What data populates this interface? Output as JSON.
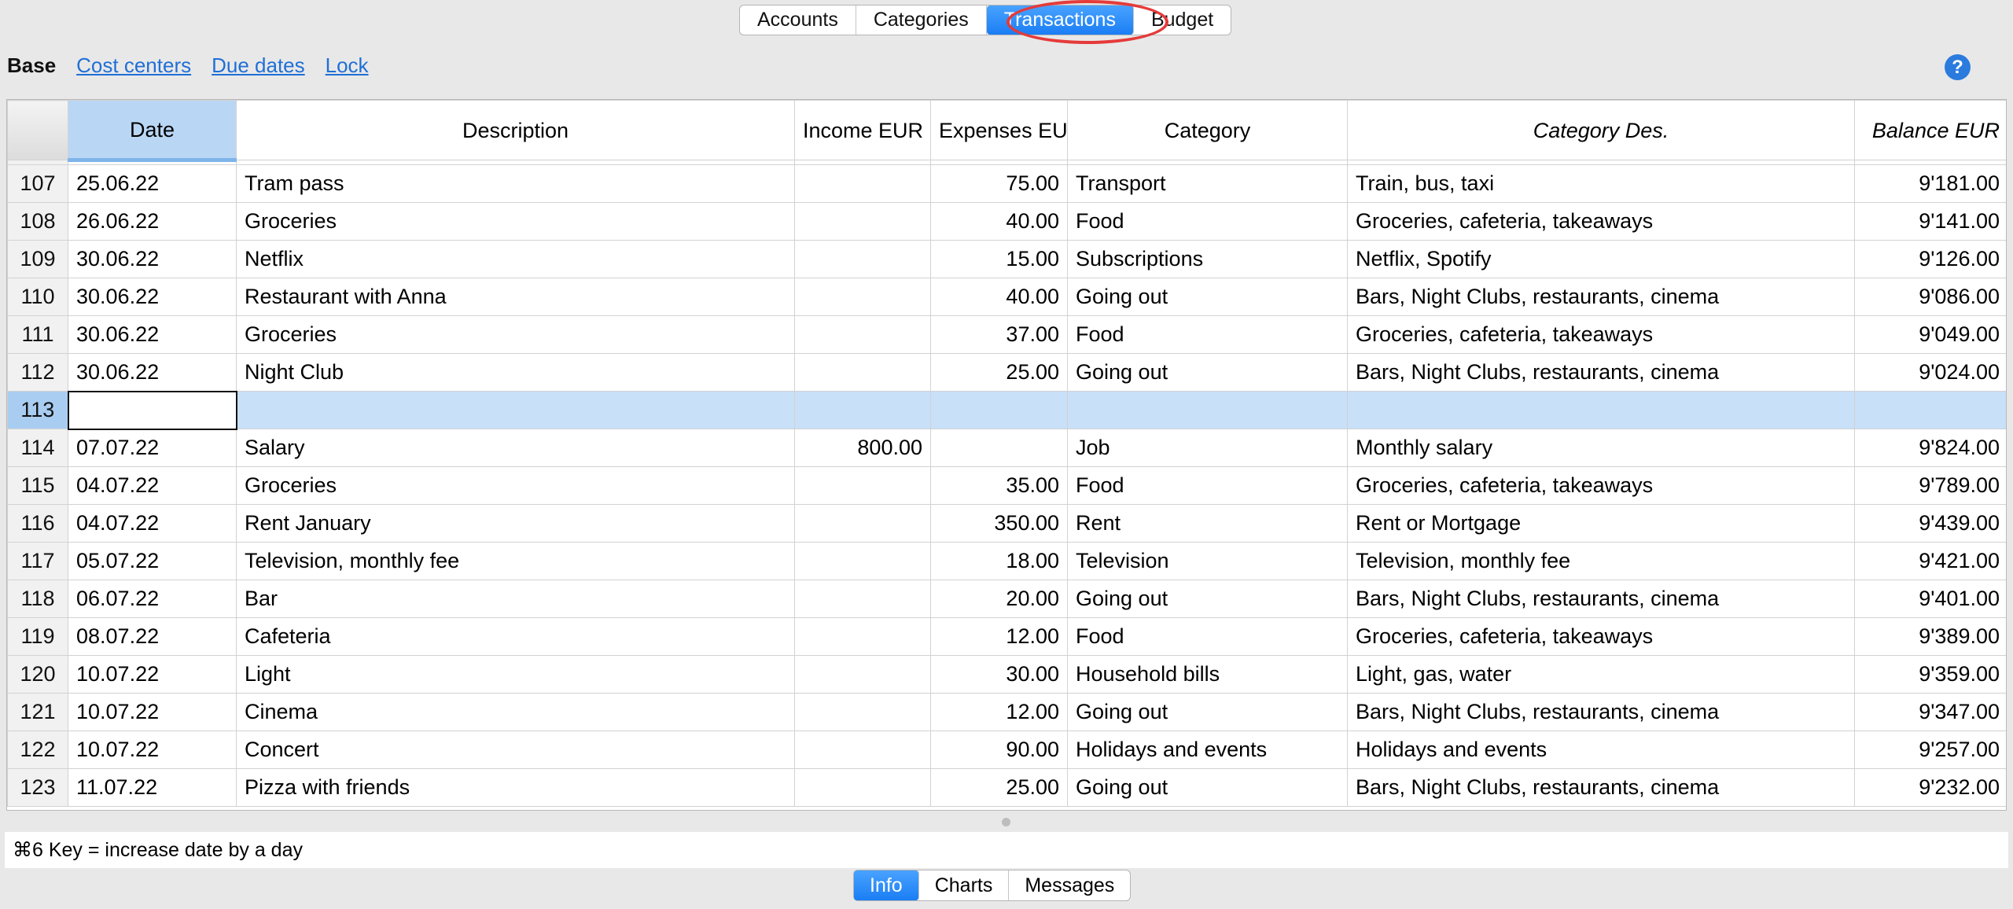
{
  "top_tabs": [
    "Accounts",
    "Categories",
    "Transactions",
    "Budget"
  ],
  "active_top_tab": "Transactions",
  "view_bar": {
    "base": "Base",
    "links": [
      "Cost centers",
      "Due dates",
      "Lock"
    ]
  },
  "help_label": "?",
  "table": {
    "columns": [
      "Date",
      "Description",
      "Income EUR",
      "Expenses EUR",
      "Category",
      "Category Des.",
      "Balance EUR"
    ],
    "rows": [
      {
        "n": "107",
        "date": "25.06.22",
        "desc": "Tram pass",
        "income": "",
        "expenses": "75.00",
        "category": "Transport",
        "catdes": "Train, bus, taxi",
        "balance": "9'181.00"
      },
      {
        "n": "108",
        "date": "26.06.22",
        "desc": "Groceries",
        "income": "",
        "expenses": "40.00",
        "category": "Food",
        "catdes": "Groceries, cafeteria, takeaways",
        "balance": "9'141.00"
      },
      {
        "n": "109",
        "date": "30.06.22",
        "desc": "Netflix",
        "income": "",
        "expenses": "15.00",
        "category": "Subscriptions",
        "catdes": "Netflix, Spotify",
        "balance": "9'126.00"
      },
      {
        "n": "110",
        "date": "30.06.22",
        "desc": "Restaurant with Anna",
        "income": "",
        "expenses": "40.00",
        "category": "Going out",
        "catdes": "Bars, Night Clubs, restaurants, cinema",
        "balance": "9'086.00"
      },
      {
        "n": "111",
        "date": "30.06.22",
        "desc": "Groceries",
        "income": "",
        "expenses": "37.00",
        "category": "Food",
        "catdes": "Groceries, cafeteria, takeaways",
        "balance": "9'049.00"
      },
      {
        "n": "112",
        "date": "30.06.22",
        "desc": "Night Club",
        "income": "",
        "expenses": "25.00",
        "category": "Going out",
        "catdes": "Bars, Night Clubs, restaurants, cinema",
        "balance": "9'024.00"
      },
      {
        "n": "113",
        "date": "",
        "desc": "",
        "income": "",
        "expenses": "",
        "category": "",
        "catdes": "",
        "balance": ""
      },
      {
        "n": "114",
        "date": "07.07.22",
        "desc": "Salary",
        "income": "800.00",
        "expenses": "",
        "category": "Job",
        "catdes": "Monthly salary",
        "balance": "9'824.00"
      },
      {
        "n": "115",
        "date": "04.07.22",
        "desc": "Groceries",
        "income": "",
        "expenses": "35.00",
        "category": "Food",
        "catdes": "Groceries, cafeteria, takeaways",
        "balance": "9'789.00"
      },
      {
        "n": "116",
        "date": "04.07.22",
        "desc": "Rent January",
        "income": "",
        "expenses": "350.00",
        "category": "Rent",
        "catdes": "Rent or Mortgage",
        "balance": "9'439.00"
      },
      {
        "n": "117",
        "date": "05.07.22",
        "desc": "Television, monthly fee",
        "income": "",
        "expenses": "18.00",
        "category": "Television",
        "catdes": "Television, monthly fee",
        "balance": "9'421.00"
      },
      {
        "n": "118",
        "date": "06.07.22",
        "desc": "Bar",
        "income": "",
        "expenses": "20.00",
        "category": "Going out",
        "catdes": "Bars, Night Clubs, restaurants, cinema",
        "balance": "9'401.00"
      },
      {
        "n": "119",
        "date": "08.07.22",
        "desc": "Cafeteria",
        "income": "",
        "expenses": "12.00",
        "category": "Food",
        "catdes": "Groceries, cafeteria, takeaways",
        "balance": "9'389.00"
      },
      {
        "n": "120",
        "date": "10.07.22",
        "desc": "Light",
        "income": "",
        "expenses": "30.00",
        "category": "Household bills",
        "catdes": "Light, gas, water",
        "balance": "9'359.00"
      },
      {
        "n": "121",
        "date": "10.07.22",
        "desc": "Cinema",
        "income": "",
        "expenses": "12.00",
        "category": "Going out",
        "catdes": "Bars, Night Clubs, restaurants, cinema",
        "balance": "9'347.00"
      },
      {
        "n": "122",
        "date": "10.07.22",
        "desc": "Concert",
        "income": "",
        "expenses": "90.00",
        "category": "Holidays and events",
        "catdes": "Holidays and events",
        "balance": "9'257.00"
      },
      {
        "n": "123",
        "date": "11.07.22",
        "desc": "Pizza with friends",
        "income": "",
        "expenses": "25.00",
        "category": "Going out",
        "catdes": "Bars, Night Clubs, restaurants, cinema",
        "balance": "9'232.00"
      }
    ],
    "current_row": "113"
  },
  "status_text": "⌘6 Key = increase date by a day",
  "bottom_tabs": [
    "Info",
    "Charts",
    "Messages"
  ],
  "active_bottom_tab": "Info",
  "colors": {
    "accent": "#1a7ef4",
    "highlight_oval": "#e53a3a",
    "selected_row": "#c8e0f8"
  }
}
